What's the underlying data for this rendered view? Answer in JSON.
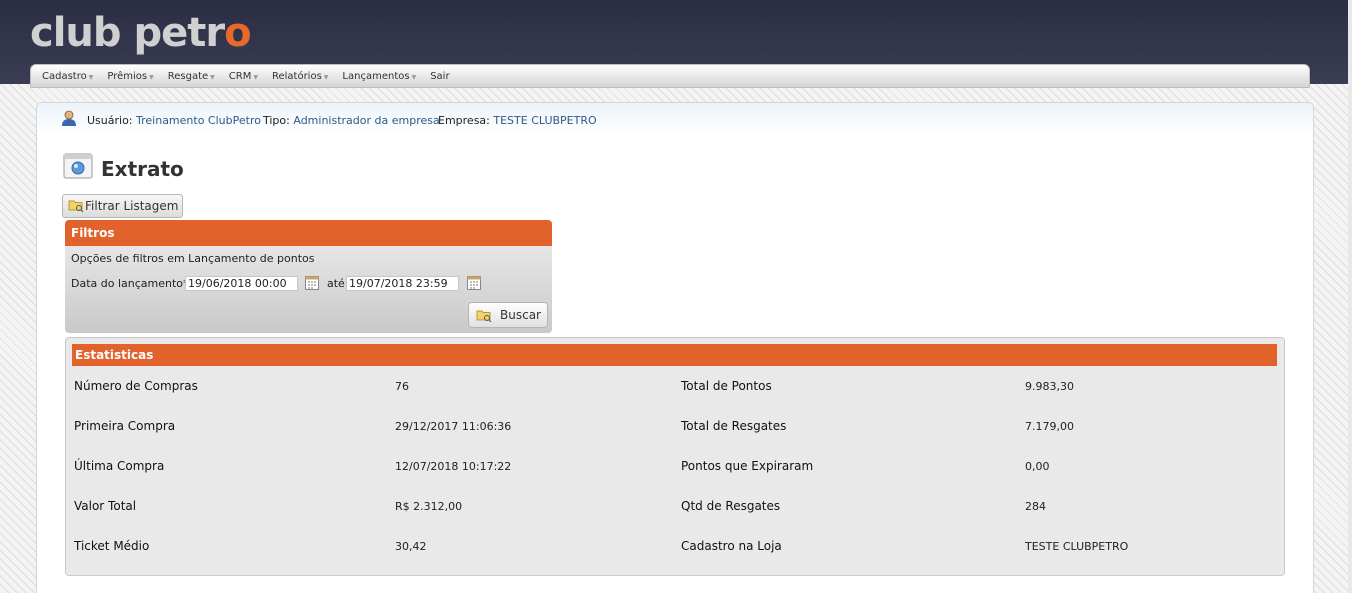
{
  "logo": {
    "text_main": "club petr",
    "text_accent": "o"
  },
  "nav": {
    "items": [
      "Cadastro",
      "Prêmios",
      "Resgate",
      "CRM",
      "Relatórios",
      "Lançamentos",
      "Sair"
    ]
  },
  "info": {
    "user_label": "Usuário:",
    "user_value": "Treinamento ClubPetro",
    "type_label": "Tipo:",
    "type_value": "Administrador da empresa",
    "company_label": "Empresa:",
    "company_value": "TESTE CLUBPETRO"
  },
  "page_title": "Extrato",
  "filter_button": "Filtrar Listagem",
  "filters": {
    "title": "Filtros",
    "description": "Opções de filtros em Lançamento de pontos",
    "date_label": "Data do lançamento*:",
    "date_from": "19/06/2018 00:00",
    "until_label": "até",
    "date_to": "19/07/2018 23:59",
    "search_button": "Buscar"
  },
  "stats": {
    "title": "Estatisticas",
    "left": [
      {
        "label": "Número de Compras",
        "value": "76"
      },
      {
        "label": "Primeira Compra",
        "value": "29/12/2017 11:06:36"
      },
      {
        "label": "Última Compra",
        "value": "12/07/2018 10:17:22"
      },
      {
        "label": "Valor Total",
        "value": "R$ 2.312,00"
      },
      {
        "label": "Ticket Médio",
        "value": "30,42"
      }
    ],
    "right": [
      {
        "label": "Total de Pontos",
        "value": "9.983,30"
      },
      {
        "label": "Total de Resgates",
        "value": "7.179,00"
      },
      {
        "label": "Pontos que Expiraram",
        "value": "0,00"
      },
      {
        "label": "Qtd de Resgates",
        "value": "284"
      },
      {
        "label": "Cadastro na Loja",
        "value": "TESTE CLUBPETRO"
      }
    ]
  },
  "colors": {
    "accent": "#e2622c",
    "header": "#2b2d44",
    "link": "#2e5b86"
  }
}
